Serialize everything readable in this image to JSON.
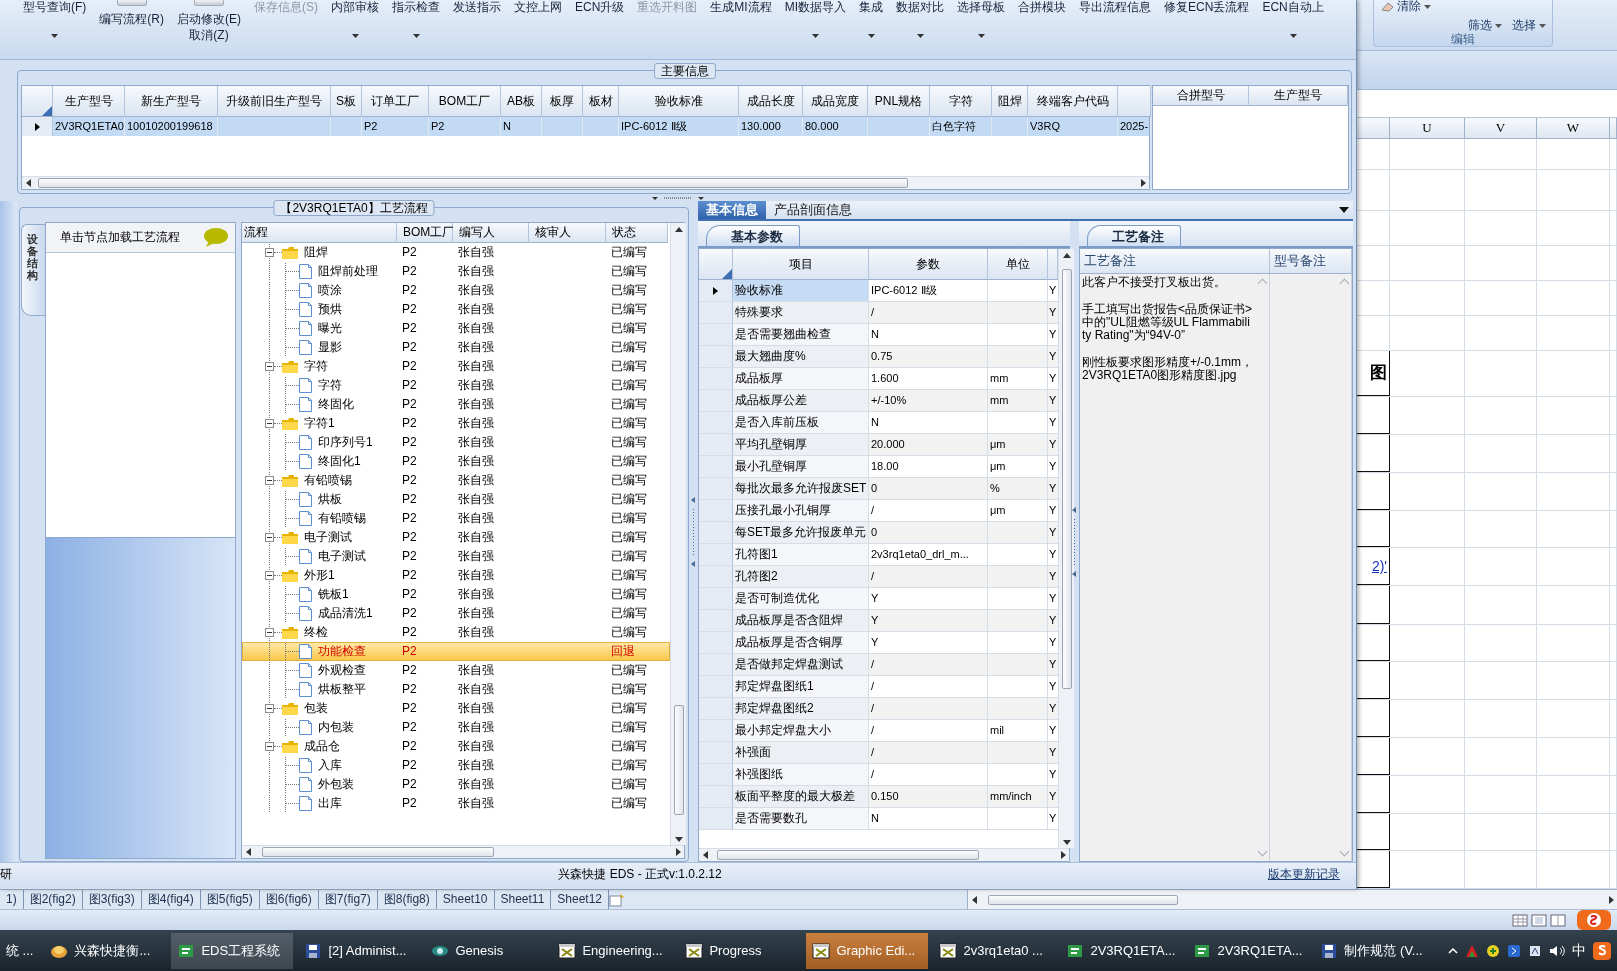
{
  "toolbar": {
    "items": [
      {
        "label": "型号查询(F)",
        "kind": "small",
        "disabled": false,
        "dropdown": true
      },
      {
        "label": "编写流程(R)",
        "kind": "large",
        "disabled": false,
        "dropdown": false
      },
      {
        "label": "启动修改(E)",
        "sub_label": "取消(Z)",
        "kind": "large",
        "disabled": false,
        "dropdown": false
      },
      {
        "label": "保存信息(S)",
        "kind": "small",
        "disabled": true,
        "dropdown": false
      },
      {
        "label": "内部审核",
        "kind": "small",
        "disabled": false,
        "dropdown": true
      },
      {
        "label": "指示检查",
        "kind": "small",
        "disabled": false,
        "dropdown": true
      },
      {
        "label": "发送指示",
        "kind": "small",
        "disabled": false,
        "dropdown": false
      },
      {
        "label": "文控上网",
        "kind": "small",
        "disabled": false,
        "dropdown": false
      },
      {
        "label": "ECN升级",
        "kind": "small",
        "disabled": false,
        "dropdown": false
      },
      {
        "label": "重选开料图",
        "kind": "small",
        "disabled": true,
        "dropdown": false
      },
      {
        "label": "生成MI流程",
        "kind": "small",
        "disabled": false,
        "dropdown": false
      },
      {
        "label": "MI数据导入",
        "kind": "small",
        "disabled": false,
        "dropdown": true
      },
      {
        "label": "集成",
        "kind": "small",
        "disabled": false,
        "dropdown": true
      },
      {
        "label": "数据对比",
        "kind": "small",
        "disabled": false,
        "dropdown": true
      },
      {
        "label": "选择母板",
        "kind": "small",
        "disabled": false,
        "dropdown": true
      },
      {
        "label": "合拼模块",
        "kind": "small",
        "disabled": false,
        "dropdown": false
      },
      {
        "label": "导出流程信息",
        "kind": "small",
        "disabled": false,
        "dropdown": false
      },
      {
        "label": "修复ECN丢流程",
        "kind": "small",
        "disabled": false,
        "dropdown": false
      },
      {
        "label": "ECN自动上",
        "kind": "small",
        "disabled": false,
        "dropdown": true
      }
    ]
  },
  "main_info": {
    "title": "主要信息",
    "columns": [
      "生产型号",
      "新生产型号",
      "升级前旧生产型号",
      "S板",
      "订单工厂",
      "BOM工厂",
      "AB板",
      "板厚",
      "板材",
      "验收标准",
      "成品长度",
      "成品宽度",
      "PNL规格",
      "字符",
      "阻焊",
      "终端客户代码"
    ],
    "rows": [
      {
        "selected": true,
        "cells": [
          "2V3RQ1ETA0",
          "10010200199618",
          null,
          null,
          "P2",
          "P2",
          "N",
          null,
          null,
          "IPC-6012 Ⅱ级",
          "130.000",
          "80.000",
          null,
          "白色字符",
          null,
          "V3RQ",
          "2025-"
        ]
      }
    ],
    "merge_columns": [
      "合拼型号",
      "生产型号"
    ]
  },
  "process": {
    "title": "【2V3RQ1ETA0】工艺流程",
    "side_tab": "设备结构",
    "side_header": "单击节点加载工艺流程",
    "columns": [
      "流程",
      "BOM工厂",
      "编写人",
      "核审人",
      "状态"
    ],
    "tree": [
      {
        "label": "阻焊",
        "factory": "P2",
        "writer": "张自强",
        "status": "已编写",
        "selected": false,
        "returned": false,
        "expanded": true,
        "children": [
          {
            "label": "阻焊前处理",
            "factory": "P2",
            "writer": "张自强",
            "status": "已编写",
            "selected": false,
            "returned": false
          },
          {
            "label": "喷涂",
            "factory": "P2",
            "writer": "张自强",
            "status": "已编写",
            "selected": false,
            "returned": false
          },
          {
            "label": "预烘",
            "factory": "P2",
            "writer": "张自强",
            "status": "已编写",
            "selected": false,
            "returned": false
          },
          {
            "label": "曝光",
            "factory": "P2",
            "writer": "张自强",
            "status": "已编写",
            "selected": false,
            "returned": false
          },
          {
            "label": "显影",
            "factory": "P2",
            "writer": "张自强",
            "status": "已编写",
            "selected": false,
            "returned": false
          }
        ]
      },
      {
        "label": "字符",
        "factory": "P2",
        "writer": "张自强",
        "status": "已编写",
        "selected": false,
        "returned": false,
        "expanded": true,
        "children": [
          {
            "label": "字符",
            "factory": "P2",
            "writer": "张自强",
            "status": "已编写",
            "selected": false,
            "returned": false
          },
          {
            "label": "终固化",
            "factory": "P2",
            "writer": "张自强",
            "status": "已编写",
            "selected": false,
            "returned": false
          }
        ]
      },
      {
        "label": "字符1",
        "factory": "P2",
        "writer": "张自强",
        "status": "已编写",
        "selected": false,
        "returned": false,
        "expanded": true,
        "children": [
          {
            "label": "印序列号1",
            "factory": "P2",
            "writer": "张自强",
            "status": "已编写",
            "selected": false,
            "returned": false
          },
          {
            "label": "终固化1",
            "factory": "P2",
            "writer": "张自强",
            "status": "已编写",
            "selected": false,
            "returned": false
          }
        ]
      },
      {
        "label": "有铅喷锡",
        "factory": "P2",
        "writer": "张自强",
        "status": "已编写",
        "selected": false,
        "returned": false,
        "expanded": true,
        "children": [
          {
            "label": "烘板",
            "factory": "P2",
            "writer": "张自强",
            "status": "已编写",
            "selected": false,
            "returned": false
          },
          {
            "label": "有铅喷锡",
            "factory": "P2",
            "writer": "张自强",
            "status": "已编写",
            "selected": false,
            "returned": false
          }
        ]
      },
      {
        "label": "电子测试",
        "factory": "P2",
        "writer": "张自强",
        "status": "已编写",
        "selected": false,
        "returned": false,
        "expanded": true,
        "children": [
          {
            "label": "电子测试",
            "factory": "P2",
            "writer": "张自强",
            "status": "已编写",
            "selected": false,
            "returned": false
          }
        ]
      },
      {
        "label": "外形1",
        "factory": "P2",
        "writer": "张自强",
        "status": "已编写",
        "selected": false,
        "returned": false,
        "expanded": true,
        "children": [
          {
            "label": "铣板1",
            "factory": "P2",
            "writer": "张自强",
            "status": "已编写",
            "selected": false,
            "returned": false
          },
          {
            "label": "成品清洗1",
            "factory": "P2",
            "writer": "张自强",
            "status": "已编写",
            "selected": false,
            "returned": false
          }
        ]
      },
      {
        "label": "终检",
        "factory": "P2",
        "writer": "张自强",
        "status": "已编写",
        "selected": false,
        "returned": false,
        "expanded": true,
        "children": [
          {
            "label": "功能检查",
            "factory": "P2",
            "status": "回退",
            "selected": true,
            "returned": true
          },
          {
            "label": "外观检查",
            "factory": "P2",
            "writer": "张自强",
            "status": "已编写",
            "selected": false,
            "returned": false
          },
          {
            "label": "烘板整平",
            "factory": "P2",
            "writer": "张自强",
            "status": "已编写",
            "selected": false,
            "returned": false
          }
        ]
      },
      {
        "label": "包装",
        "factory": "P2",
        "writer": "张自强",
        "status": "已编写",
        "selected": false,
        "returned": false,
        "expanded": true,
        "children": [
          {
            "label": "内包装",
            "factory": "P2",
            "writer": "张自强",
            "status": "已编写",
            "selected": false,
            "returned": false
          }
        ]
      },
      {
        "label": "成品仓",
        "factory": "P2",
        "writer": "张自强",
        "status": "已编写",
        "selected": false,
        "returned": false,
        "expanded": true,
        "children": [
          {
            "label": "入库",
            "factory": "P2",
            "writer": "张自强",
            "status": "已编写",
            "selected": false,
            "returned": false
          },
          {
            "label": "外包装",
            "factory": "P2",
            "writer": "张自强",
            "status": "已编写",
            "selected": false,
            "returned": false
          },
          {
            "label": "出库",
            "factory": "P2",
            "writer": "张自强",
            "status": "已编写",
            "selected": false,
            "returned": false
          }
        ]
      }
    ]
  },
  "params": {
    "tabs": [
      {
        "label": "基本信息",
        "selected": true
      },
      {
        "label": "产品剖面信息",
        "selected": false
      }
    ],
    "panel_title": "基本参数",
    "columns": [
      "项目",
      "参数",
      "单位"
    ],
    "rows": [
      {
        "item": "验收标准",
        "value": "IPC-6012 Ⅱ级",
        "column_4": "Y",
        "selected": true
      },
      {
        "item": "特殊要求",
        "value": "/",
        "column_4": "Y",
        "selected": false
      },
      {
        "item": "是否需要翘曲检查",
        "value": "N",
        "column_4": "Y",
        "selected": false
      },
      {
        "item": "最大翘曲度%",
        "value": "0.75",
        "column_4": "Y",
        "selected": false
      },
      {
        "item": "成品板厚",
        "value": "1.600",
        "unit": "mm",
        "column_4": "Y",
        "selected": false
      },
      {
        "item": "成品板厚公差",
        "value": "+/-10%",
        "unit": "mm",
        "column_4": "Y",
        "selected": false
      },
      {
        "item": "是否入库前压板",
        "value": "N",
        "column_4": "Y",
        "selected": false
      },
      {
        "item": "平均孔壁铜厚",
        "value": "20.000",
        "unit": "μm",
        "column_4": "Y",
        "selected": false
      },
      {
        "item": "最小孔壁铜厚",
        "value": "18.00",
        "unit": "μm",
        "column_4": "Y",
        "selected": false
      },
      {
        "item": "每批次最多允许报废SET",
        "value": "0",
        "unit": "%",
        "column_4": "Y",
        "selected": false
      },
      {
        "item": "压接孔最小孔铜厚",
        "value": "/",
        "unit": "μm",
        "column_4": "Y",
        "selected": false
      },
      {
        "item": "每SET最多允许报废单元",
        "value": "0",
        "column_4": "Y",
        "selected": false
      },
      {
        "item": "孔符图1",
        "value": "2v3rq1eta0_drl_m...",
        "column_4": "Y",
        "selected": false
      },
      {
        "item": "孔符图2",
        "value": "/",
        "column_4": "Y",
        "selected": false
      },
      {
        "item": "是否可制造优化",
        "value": "Y",
        "column_4": "Y",
        "selected": false
      },
      {
        "item": "成品板厚是否含阻焊",
        "value": "Y",
        "column_4": "Y",
        "selected": false
      },
      {
        "item": "成品板厚是否含铜厚",
        "value": "Y",
        "column_4": "Y",
        "selected": false
      },
      {
        "item": "是否做邦定焊盘测试",
        "value": "/",
        "column_4": "Y",
        "selected": false
      },
      {
        "item": "邦定焊盘图纸1",
        "value": "/",
        "column_4": "Y",
        "selected": false
      },
      {
        "item": "邦定焊盘图纸2",
        "value": "/",
        "column_4": "Y",
        "selected": false
      },
      {
        "item": "最小邦定焊盘大小",
        "value": "/",
        "unit": "mil",
        "column_4": "Y",
        "selected": false
      },
      {
        "item": "补强面",
        "value": "/",
        "column_4": "Y",
        "selected": false
      },
      {
        "item": "补强图纸",
        "value": "/",
        "column_4": "Y",
        "selected": false
      },
      {
        "item": "板面平整度的最大极差",
        "value": "0.150",
        "unit": "mm/inch",
        "column_4": "Y",
        "selected": false
      },
      {
        "item": "是否需要数孔",
        "value": "N",
        "column_4": "Y",
        "selected": false
      }
    ]
  },
  "notes": {
    "panel_title": "工艺备注",
    "columns": [
      "工艺备注",
      "型号备注"
    ],
    "paragraphs": [
      "此客户不接受打叉板出货。",
      "手工填写出货报告<品质保证书>中的\"UL阻燃等级UL Flammability Rating\"为“94V-0”",
      "刚性板要求图形精度+/-0.1mm，2V3RQ1ETA0图形精度图.jpg"
    ]
  },
  "status_bar": {
    "left": "研",
    "center": "兴森快捷 EDS - 正式v:1.0.2.12",
    "link": "版本更新记录"
  },
  "excel": {
    "ribbon": {
      "buttons": [
        "清除",
        "筛选",
        "选择"
      ],
      "group": "编辑"
    },
    "column_headers": [
      "U",
      "V",
      "W"
    ],
    "table_cells": [
      {
        "kind": "heading",
        "text": "图"
      },
      {
        "kind": "blank"
      },
      {
        "kind": "blank"
      },
      {
        "kind": "blank"
      },
      {
        "kind": "blank"
      },
      {
        "kind": "link",
        "text": "2)'"
      },
      {
        "kind": "blank"
      },
      {
        "kind": "blank"
      },
      {
        "kind": "blank"
      },
      {
        "kind": "blank"
      },
      {
        "kind": "blank"
      },
      {
        "kind": "blank"
      },
      {
        "kind": "blank"
      },
      {
        "kind": "blank"
      }
    ],
    "sheet_tabs": [
      "1)",
      "图2(fig2)",
      "图3(fig3)",
      "图4(fig4)",
      "图5(fig5)",
      "图6(fig6)",
      "图7(fig7)",
      "图8(fig8)",
      "Sheet10",
      "Sheet11",
      "Sheet12"
    ]
  },
  "taskbar": {
    "items": [
      {
        "label": "统 ...",
        "selected": false,
        "highlighted": false
      },
      {
        "label": "兴森快捷衡...",
        "selected": false,
        "highlighted": false
      },
      {
        "label": "EDS工程系统",
        "selected": false,
        "highlighted": true
      },
      {
        "label": "[2] Administ...",
        "selected": false,
        "highlighted": false
      },
      {
        "label": "Genesis",
        "selected": false,
        "highlighted": false
      },
      {
        "label": "Engineering...",
        "selected": false,
        "highlighted": false
      },
      {
        "label": "Progress",
        "selected": false,
        "highlighted": false
      },
      {
        "label": "Graphic Edi...",
        "selected": true,
        "highlighted": false
      },
      {
        "label": "2v3rq1eta0 ...",
        "selected": false,
        "highlighted": false
      },
      {
        "label": "2V3RQ1ETA...",
        "selected": false,
        "highlighted": false
      },
      {
        "label": "2V3RQ1ETA...",
        "selected": false,
        "highlighted": false
      },
      {
        "label": "制作规范 (V...",
        "selected": false,
        "highlighted": false
      }
    ],
    "tray": {
      "ime": "中"
    }
  }
}
